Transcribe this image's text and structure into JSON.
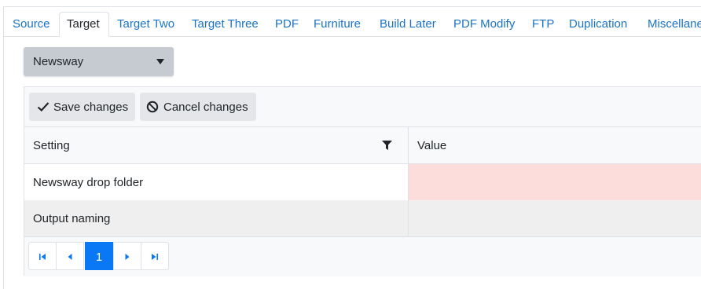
{
  "tabs": [
    {
      "label": "Source",
      "active": false
    },
    {
      "label": "Target",
      "active": true
    },
    {
      "label": "Target Two",
      "active": false
    },
    {
      "label": "Target Three",
      "active": false
    },
    {
      "label": "PDF",
      "active": false
    },
    {
      "label": "Furniture",
      "active": false
    },
    {
      "label": "Build Later",
      "active": false
    },
    {
      "label": "PDF Modify",
      "active": false
    },
    {
      "label": "FTP",
      "active": false
    },
    {
      "label": "Duplication",
      "active": false
    },
    {
      "label": "Miscellane",
      "active": false
    }
  ],
  "target_select": {
    "value": "Newsway",
    "icon": "caret-down-icon"
  },
  "toolbar": {
    "save_label": "Save changes",
    "save_icon": "check-icon",
    "cancel_label": "Cancel changes",
    "cancel_icon": "ban-icon"
  },
  "grid": {
    "columns": [
      {
        "label": "Setting",
        "icon": "filter-icon"
      },
      {
        "label": "Value"
      }
    ],
    "rows": [
      {
        "setting": "Newsway drop folder",
        "value": "",
        "invalid": true
      },
      {
        "setting": "Output naming",
        "value": "",
        "invalid": false
      }
    ],
    "colors": {
      "invalid_value": "#fddcdc",
      "alt_row": "#efefef",
      "accent": "#0a78f5"
    }
  },
  "pager": {
    "current_page": "1",
    "buttons": [
      "first-page-icon",
      "prev-page-icon",
      "next-page-icon",
      "last-page-icon"
    ]
  }
}
